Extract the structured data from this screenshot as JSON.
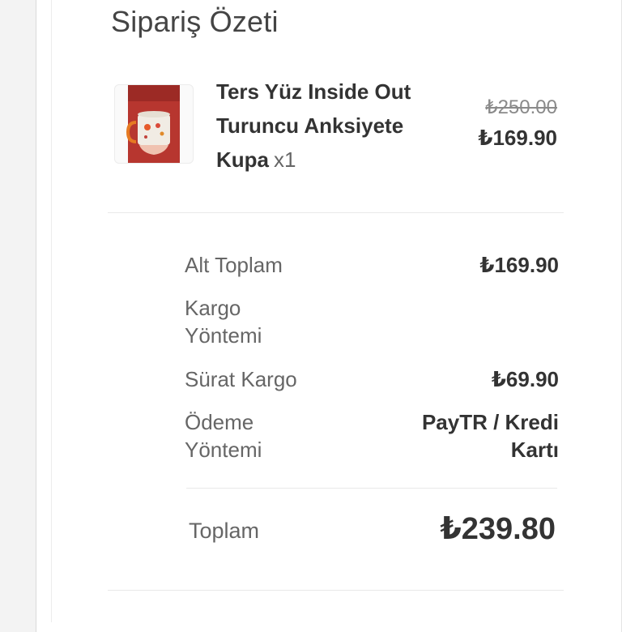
{
  "summary": {
    "title": "Sipariş Özeti"
  },
  "product": {
    "name": "Ters Yüz Inside Out Turuncu Anksiyete Kupa",
    "qty": "x1",
    "old_price": "₺250.00",
    "new_price": "₺169.90",
    "image": "product-mug-image"
  },
  "rows": {
    "subtotal_label": "Alt Toplam",
    "subtotal_value": "₺169.90",
    "shipping_method_label": "Kargo Yöntemi",
    "shipping_carrier_label": "Sürat Kargo",
    "shipping_carrier_value": "₺69.90",
    "payment_method_label": "Ödeme Yöntemi",
    "payment_method_value": "PayTR / Kredi Kartı"
  },
  "total": {
    "label": "Toplam",
    "value": "₺239.80"
  },
  "colors": {
    "background": "#f3f3f3",
    "card": "#ffffff",
    "text_dark": "#333333",
    "text_muted": "#666666",
    "divider": "#e9e9e9"
  }
}
